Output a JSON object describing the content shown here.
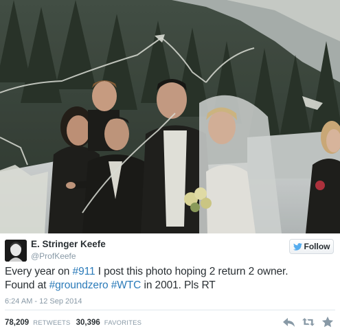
{
  "user": {
    "name": "E. Stringer Keefe",
    "handle": "@ProfKeefe"
  },
  "follow_button": {
    "label": "Follow",
    "icon": "twitter-bird-icon"
  },
  "tweet": {
    "line1_prefix": "Every year on ",
    "line1_tag": "#911",
    "line1_suffix": " I post this photo hoping 2 return 2 owner.",
    "line2_prefix": "Found at ",
    "line2_tag1": "#groundzero",
    "line2_sep": " ",
    "line2_tag2": "#WTC",
    "line2_suffix": " in 2001. Pls RT",
    "timestamp": "6:24 AM - 12 Sep 2014"
  },
  "stats": {
    "retweets_count": "78,209",
    "retweets_label": "RETWEETS",
    "favorites_count": "30,396",
    "favorites_label": "FAVORITES"
  },
  "actions": [
    "reply-icon",
    "retweet-icon",
    "favorite-icon"
  ],
  "colors": {
    "link": "#2b7bb9",
    "text": "#292f33",
    "muted": "#8899a6",
    "bird": "#55acee"
  }
}
